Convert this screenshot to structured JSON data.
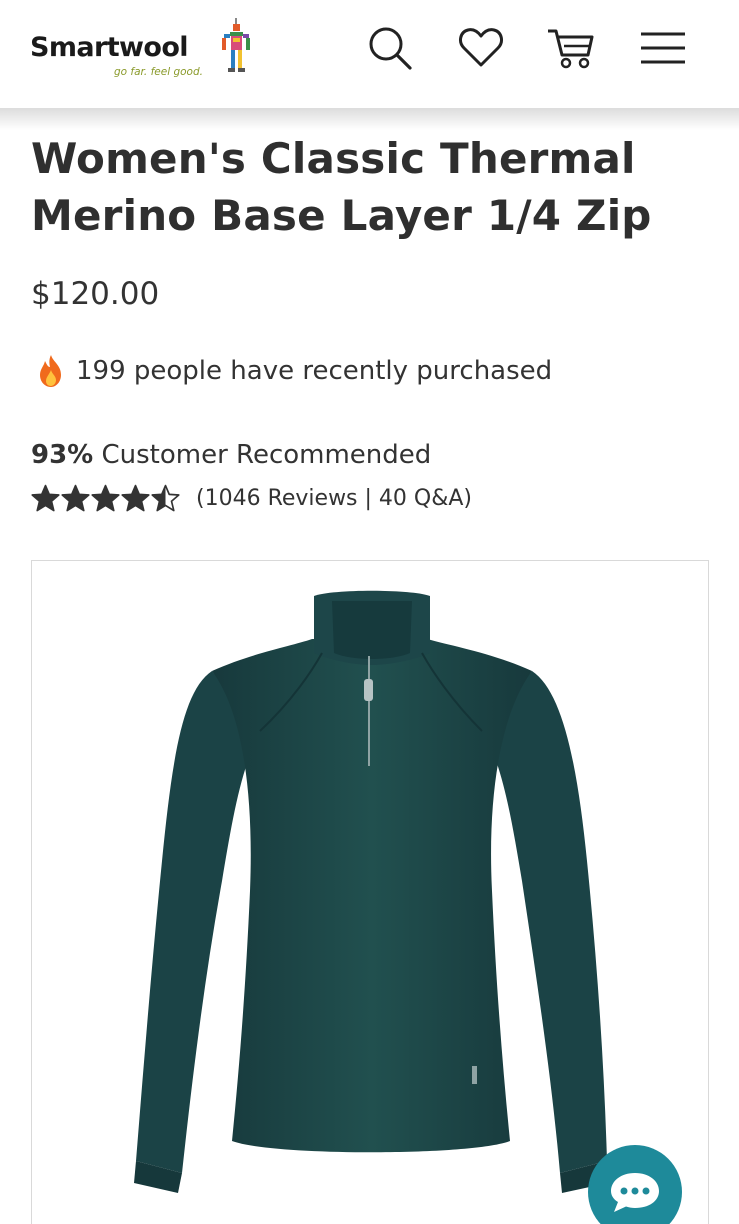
{
  "header": {
    "logo_text": "Smartwool",
    "logo_tagline": "go far. feel good."
  },
  "product": {
    "title": "Women's Classic Thermal Merino Base Layer 1/4 Zip",
    "price": "$120.00",
    "recent_purchases": "199 people have recently purchased",
    "recommend_percent": "93%",
    "recommend_label": "Customer Recommended",
    "rating_stars": 4.5,
    "reviews_summary": "(1046 Reviews | 40 Q&A)",
    "image_color": "#1f4a4d"
  },
  "colors": {
    "accent": "#1e8a9a",
    "text": "#2f2f2f"
  }
}
